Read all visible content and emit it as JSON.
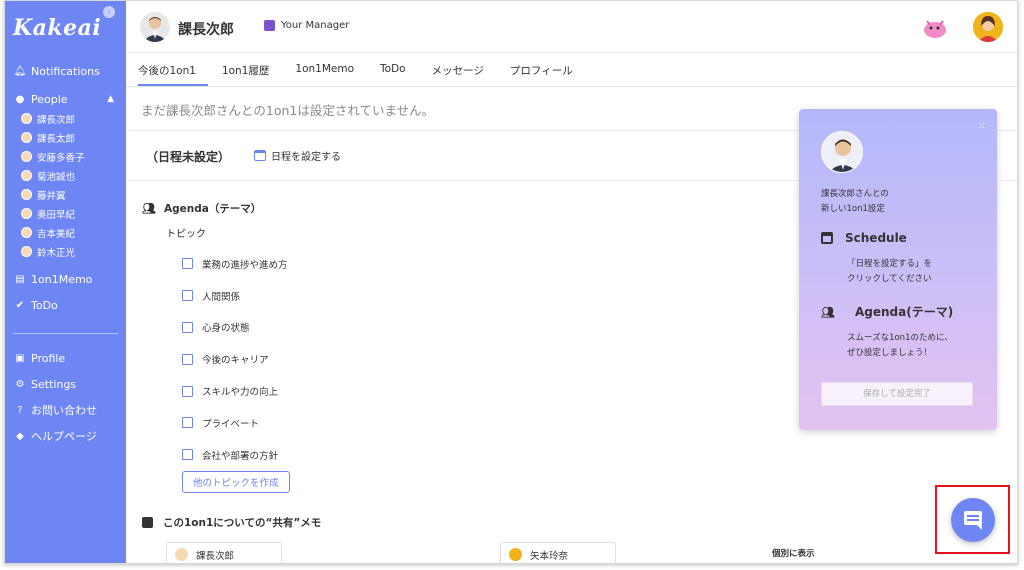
{
  "app": {
    "logo": "Kakeai"
  },
  "sidebar": {
    "notifications": "Notifications",
    "people": "People",
    "people_list": [
      "課長次郎",
      "課長太郎",
      "安藤多香子",
      "菊池誠也",
      "藤井翼",
      "奥田早紀",
      "吉本美紀",
      "鈴木正光"
    ],
    "memo": "1on1Memo",
    "todo": "ToDo",
    "profile": "Profile",
    "settings": "Settings",
    "contact": "お問い合わせ",
    "help": "ヘルプページ"
  },
  "header": {
    "name": "課長次郎",
    "badge": "Your Manager"
  },
  "tabs": [
    "今後の1on1",
    "1on1履歴",
    "1on1Memo",
    "ToDo",
    "メッセージ",
    "プロフィール"
  ],
  "main": {
    "notice": "まだ課長次郎さんとの1on1は設定されていません。",
    "schedule_title": "（日程未設定）",
    "schedule_link": "日程を設定する",
    "agenda_title": "Agenda（テーマ）",
    "topic_label": "トピック",
    "topics": [
      "業務の進捗や進め方",
      "人間関係",
      "心身の状態",
      "今後のキャリア",
      "スキルや力の向上",
      "プライベート",
      "会社や部署の方針"
    ],
    "add_topic": "他のトピックを作成",
    "memo_title": "この1on1についての“共有”メモ",
    "memo_tab1": "課長次郎",
    "memo_tab2": "矢本玲奈",
    "show_separately": "個別に表示"
  },
  "panel": {
    "intro_line1": "課長次郎さんとの",
    "intro_line2": "新しい1on1設定",
    "schedule_heading": "Schedule",
    "schedule_text1": "「日程を設定する」を",
    "schedule_text2": "クリックしてください",
    "agenda_heading": "Agenda(テーマ)",
    "agenda_text1": "スムーズな1on1のために、",
    "agenda_text2": "ぜひ設定しましょう！",
    "save": "保存して設定完了"
  },
  "colors": {
    "accent": "#6d86f3",
    "highlight": "#e5121a"
  }
}
